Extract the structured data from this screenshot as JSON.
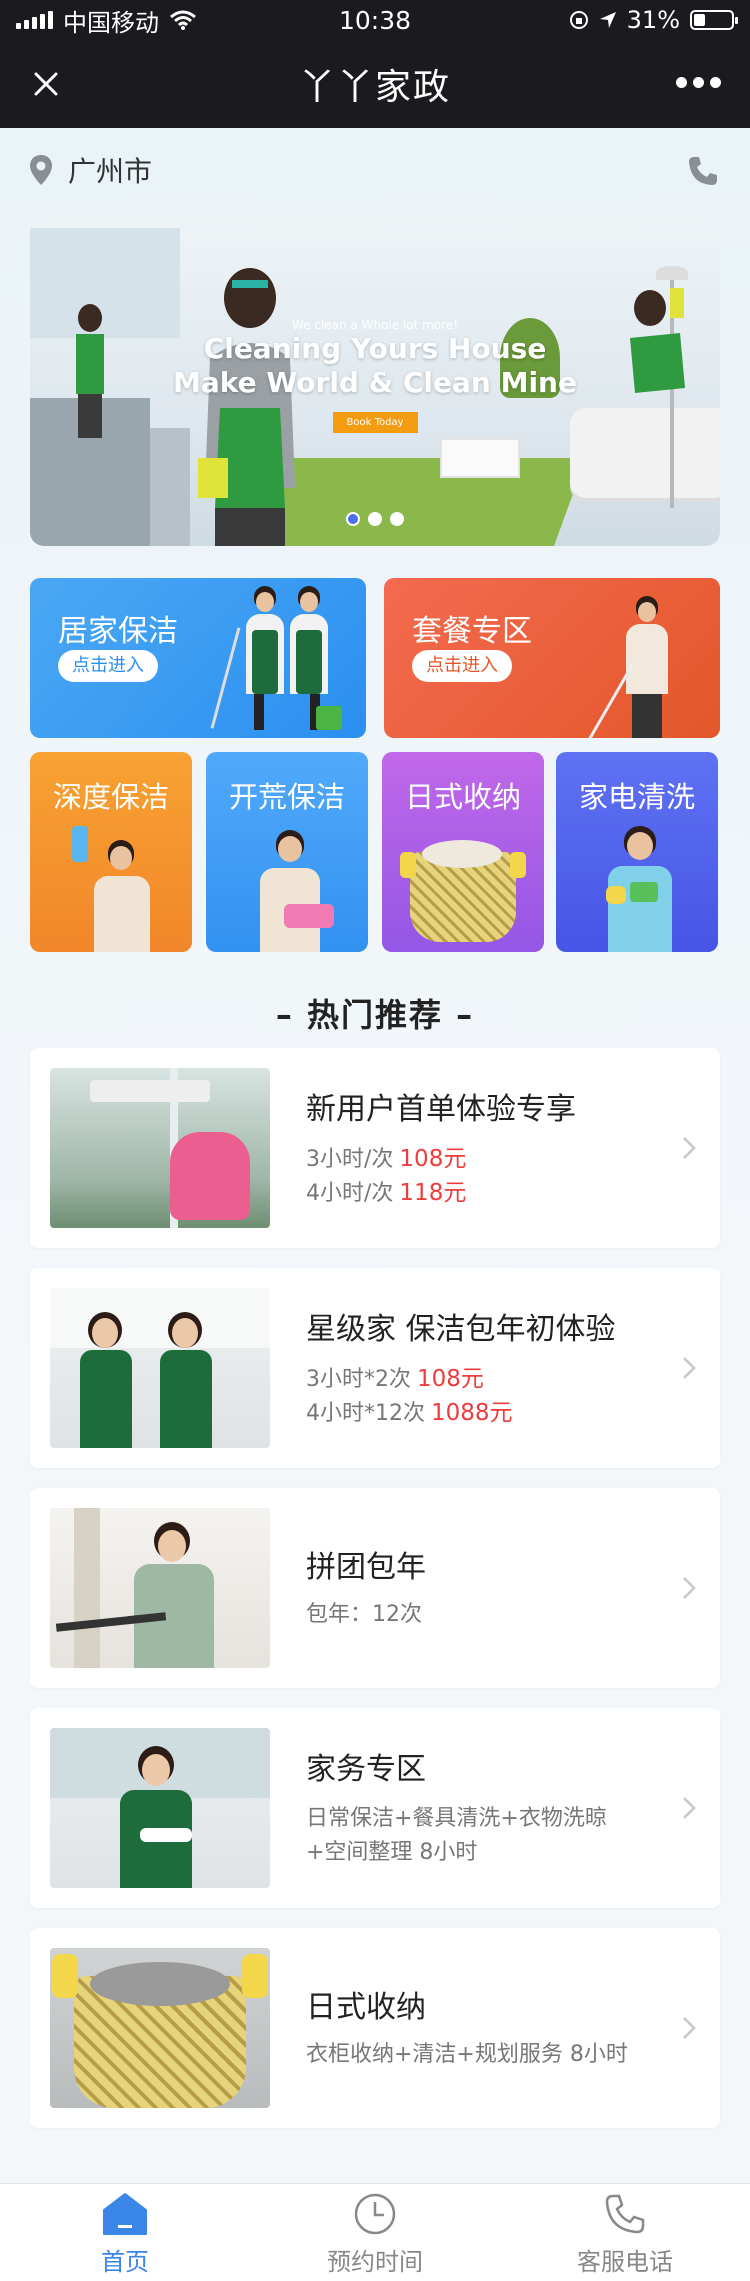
{
  "status_bar": {
    "carrier": "中国移动",
    "time": "10:38",
    "battery": "31%",
    "battery_level": 0.31
  },
  "nav": {
    "title": "丫丫家政"
  },
  "location": {
    "city": "广州市"
  },
  "banner": {
    "small": "We clean a Whole lot more!",
    "line1": "Cleaning Yours House",
    "line2": "Make World & Clean Mine",
    "button": "Book Today",
    "slide_count": 3,
    "active_slide": 1
  },
  "categories_big": [
    {
      "title": "居家保洁",
      "button": "点击进入"
    },
    {
      "title": "套餐专区",
      "button": "点击进入"
    }
  ],
  "categories_small": [
    {
      "title": "深度保洁"
    },
    {
      "title": "开荒保洁"
    },
    {
      "title": "日式收纳"
    },
    {
      "title": "家电清洗"
    }
  ],
  "section": {
    "title": "– 热门推荐 –"
  },
  "items": [
    {
      "title": "新用户首单体验专享",
      "lines": [
        {
          "text": "3小时/次",
          "price": "108元"
        },
        {
          "text": "4小时/次",
          "price": "118元"
        }
      ]
    },
    {
      "title": "星级家 保洁包年初体验",
      "lines": [
        {
          "text": "3小时*2次",
          "price": "108元"
        },
        {
          "text": "4小时*12次",
          "price": "1088元"
        }
      ]
    },
    {
      "title": "拼团包年",
      "lines": [
        {
          "text": "包年：12次",
          "price": ""
        }
      ]
    },
    {
      "title": "家务专区",
      "lines": [
        {
          "text": "日常保洁+餐具清洗+衣物洗晾",
          "price": ""
        },
        {
          "text": "+空间整理 8小时",
          "price": ""
        }
      ]
    },
    {
      "title": "日式收纳",
      "lines": [
        {
          "text": "衣柜收纳+清洁+规划服务 8小时",
          "price": ""
        }
      ]
    }
  ],
  "tabbar": [
    {
      "label": "首页",
      "icon": "home-icon",
      "active": true
    },
    {
      "label": "预约时间",
      "icon": "clock-icon",
      "active": false
    },
    {
      "label": "客服电话",
      "icon": "phone-icon",
      "active": false
    }
  ],
  "colors": {
    "accent": "#3a86e8",
    "price": "#ee3c3c",
    "nav_bg": "#1b1b1f"
  }
}
